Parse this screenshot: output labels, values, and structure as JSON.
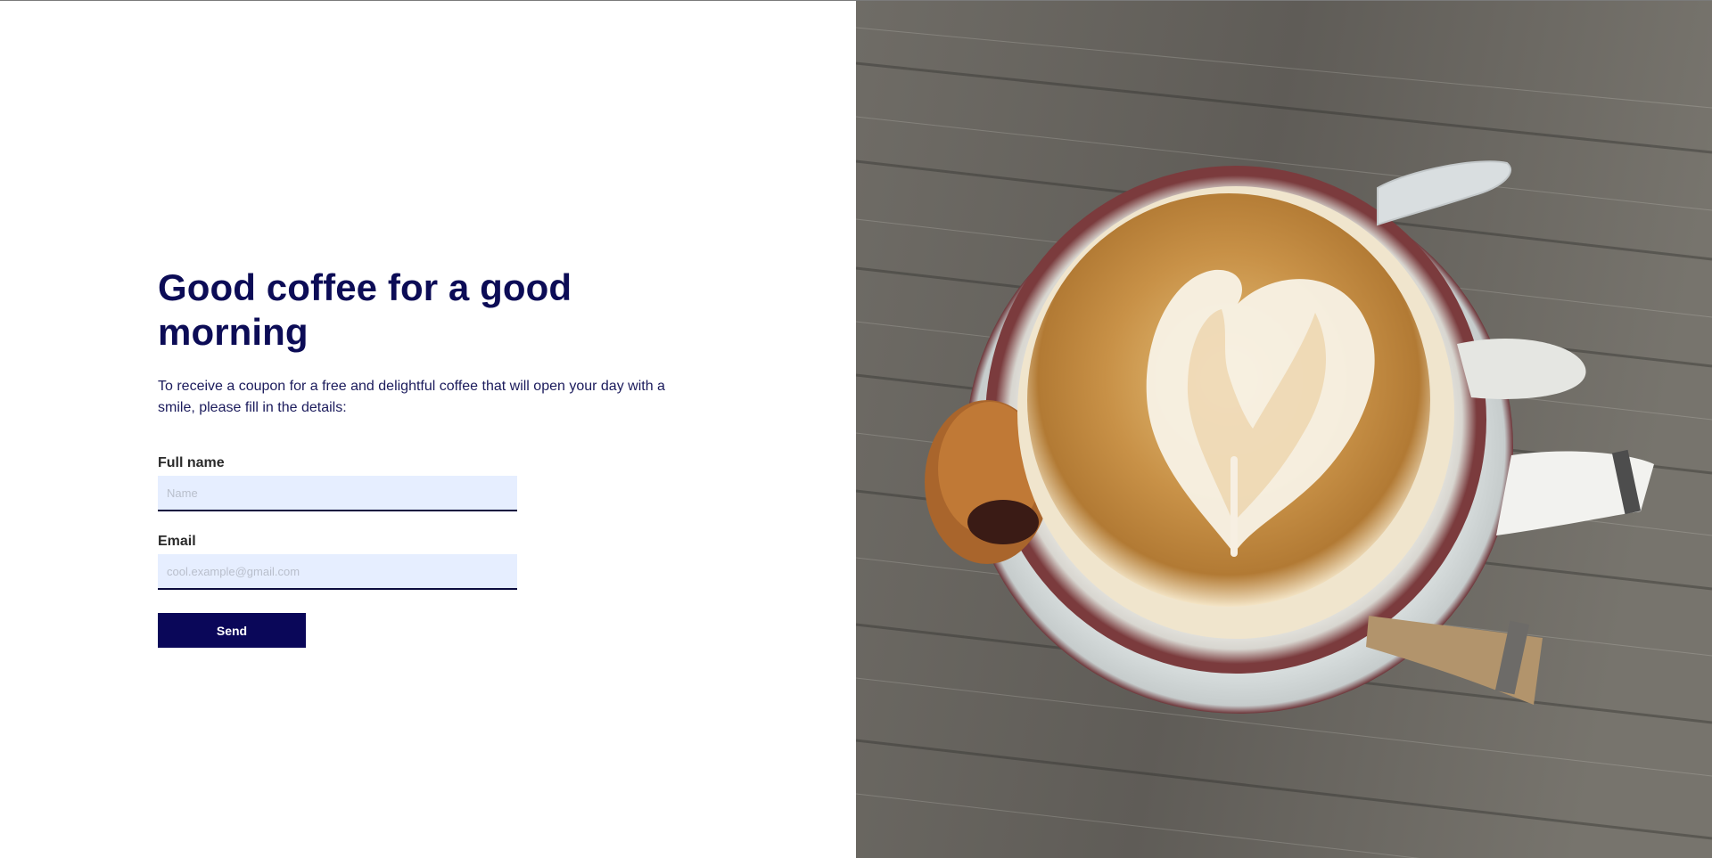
{
  "hero": {
    "title": "Good coffee for a good morning",
    "description": "To receive a coupon for a free and delightful coffee that will open your day with a smile, please fill in the details:"
  },
  "form": {
    "full_name": {
      "label": "Full name",
      "placeholder": "Name",
      "value": ""
    },
    "email": {
      "label": "Email",
      "placeholder": "cool.example@gmail.com",
      "value": ""
    },
    "submit_label": "Send"
  },
  "colors": {
    "primary": "#0a0759",
    "input_background": "#e6eeff",
    "photo_wood": "#6b6862",
    "latte_foam": "#c9923f"
  },
  "image": {
    "subject": "latte-art-coffee-photo",
    "icon": "coffee-cup-icon"
  }
}
